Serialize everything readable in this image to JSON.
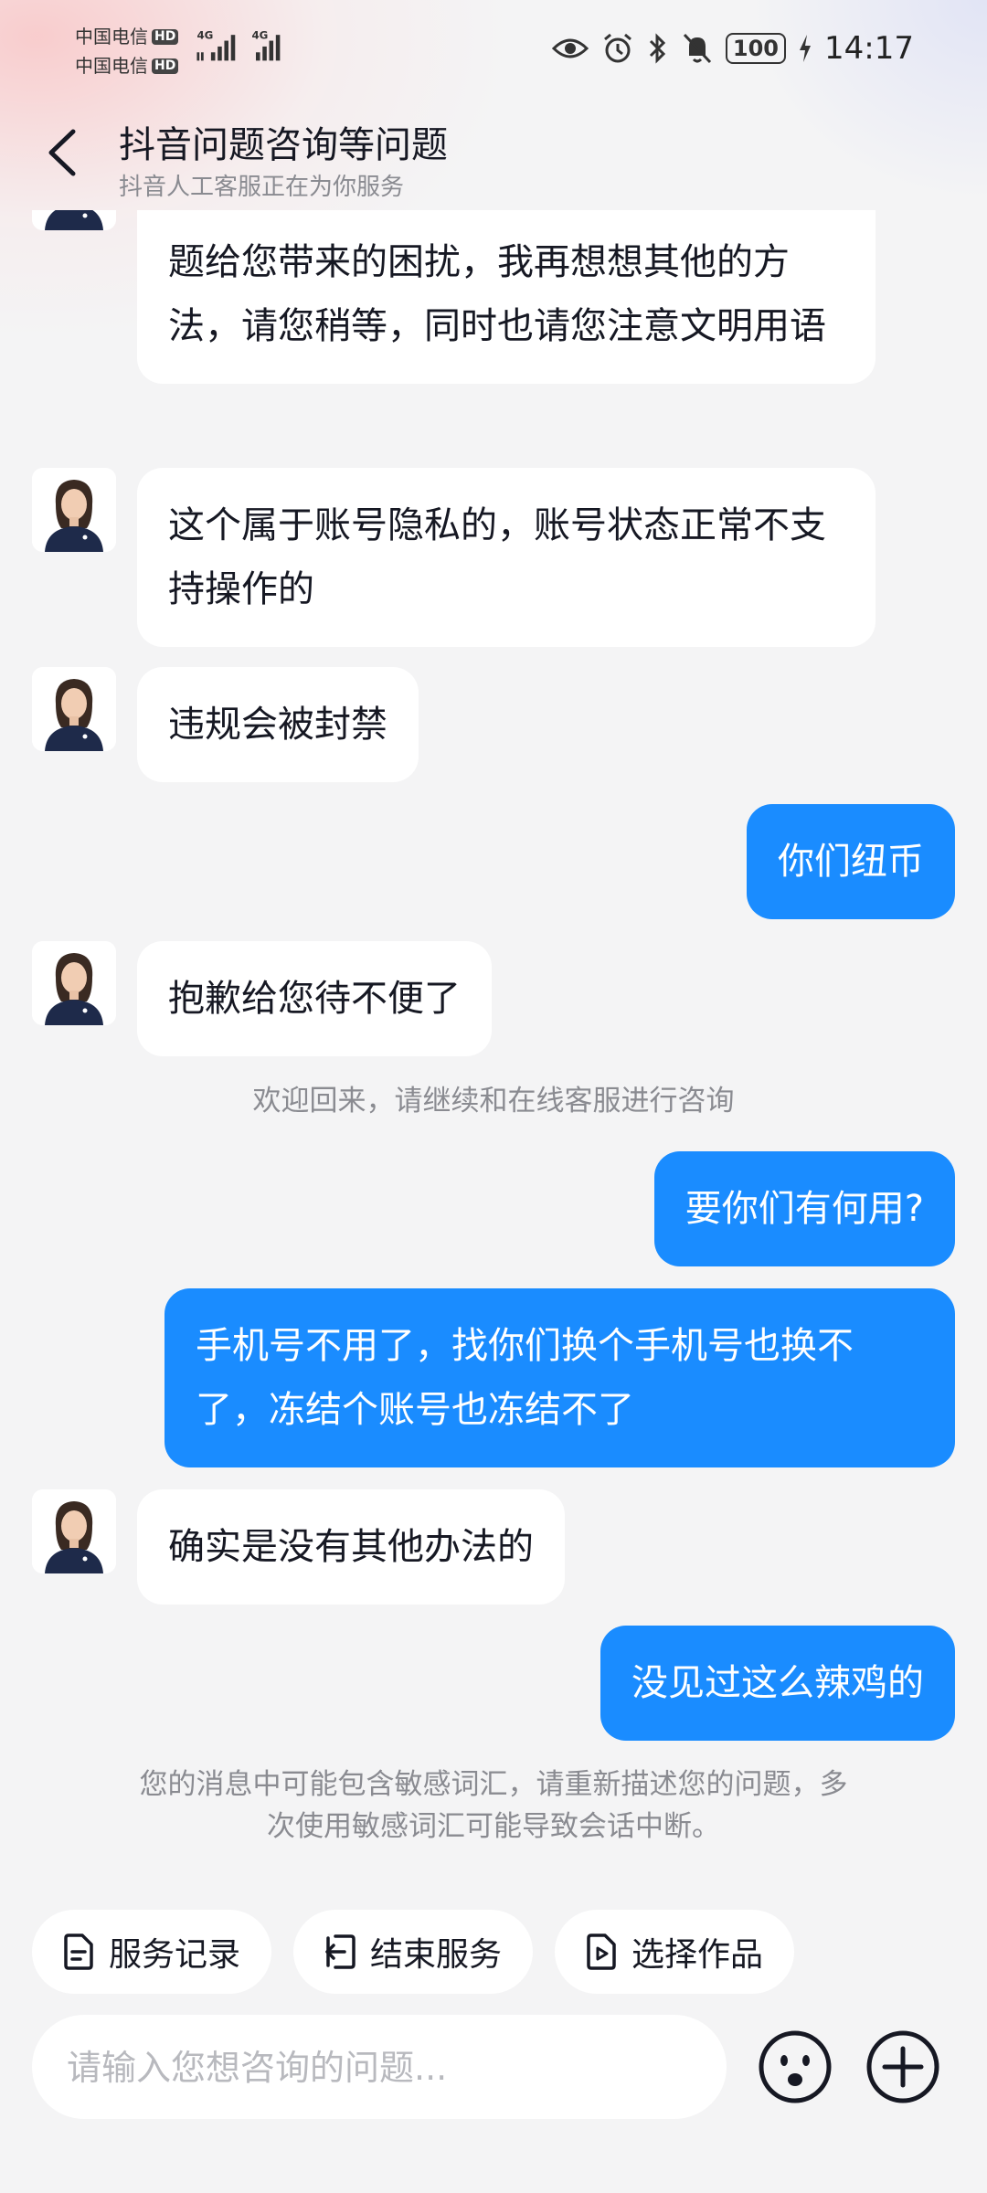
{
  "status_bar": {
    "carrier_1": "中国电信",
    "carrier_2": "中国电信",
    "hd": "HD",
    "network": "4G",
    "battery": "100",
    "time": "14:17"
  },
  "header": {
    "title": "抖音问题咨询等问题",
    "subtitle": "抖音人工客服正在为你服务"
  },
  "messages": [
    {
      "side": "left",
      "text": "题给您带来的困扰，我再想想其他的方法，请您稍等，同时也请您注意文明用语"
    },
    {
      "side": "left",
      "text": "这个属于账号隐私的，账号状态正常不支持操作的"
    },
    {
      "side": "left",
      "text": "违规会被封禁"
    },
    {
      "side": "right",
      "text": "你们纽币"
    },
    {
      "side": "left",
      "text": "抱歉给您待不便了"
    },
    {
      "side": "system",
      "text": "欢迎回来，请继续和在线客服进行咨询"
    },
    {
      "side": "right",
      "text": "要你们有何用?"
    },
    {
      "side": "right",
      "text": "手机号不用了，找你们换个手机号也换不了，冻结个账号也冻结不了"
    },
    {
      "side": "left",
      "text": "确实是没有其他办法的"
    },
    {
      "side": "right",
      "text": "没见过这么辣鸡的"
    },
    {
      "side": "system",
      "text": "您的消息中可能包含敏感词汇，请重新描述您的问题，多次使用敏感词汇可能导致会话中断。"
    }
  ],
  "quick_actions": [
    {
      "label": "服务记录",
      "icon": "document-icon"
    },
    {
      "label": "结束服务",
      "icon": "exit-icon"
    },
    {
      "label": "选择作品",
      "icon": "video-file-icon"
    }
  ],
  "input": {
    "placeholder": "请输入您想咨询的问题...",
    "value": ""
  },
  "colors": {
    "accent": "#1a8cff",
    "background": "#f4f4f5",
    "bubble_left": "#ffffff",
    "system_text": "#8a8b91"
  }
}
